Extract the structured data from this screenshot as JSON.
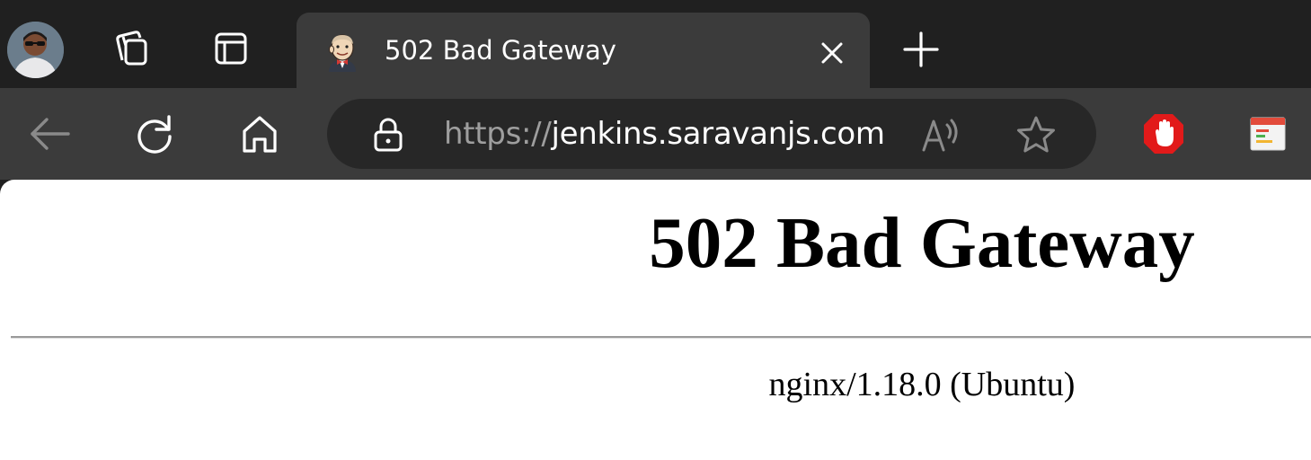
{
  "tab": {
    "title": "502 Bad Gateway",
    "favicon": "jenkins-butler-icon"
  },
  "address_bar": {
    "scheme": "https://",
    "host": "jenkins.saravanjs.com"
  },
  "page": {
    "heading": "502 Bad Gateway",
    "server": "nginx/1.18.0 (Ubuntu)"
  },
  "icons": {
    "profile": "profile-avatar",
    "workspaces": "workspaces-icon",
    "tab_actions": "tab-actions-icon",
    "close": "close-icon",
    "new_tab": "plus-icon",
    "back": "back-arrow-icon",
    "refresh": "refresh-icon",
    "home": "home-icon",
    "lock": "lock-icon",
    "read_aloud": "read-aloud-icon",
    "favorite": "star-icon",
    "adblock": "adblock-hand-icon",
    "extension2": "extension-card-icon"
  },
  "colors": {
    "chrome_dark": "#202020",
    "toolbar": "#3b3b3b",
    "omnibox": "#272727",
    "adblock_red": "#e21a1a"
  }
}
